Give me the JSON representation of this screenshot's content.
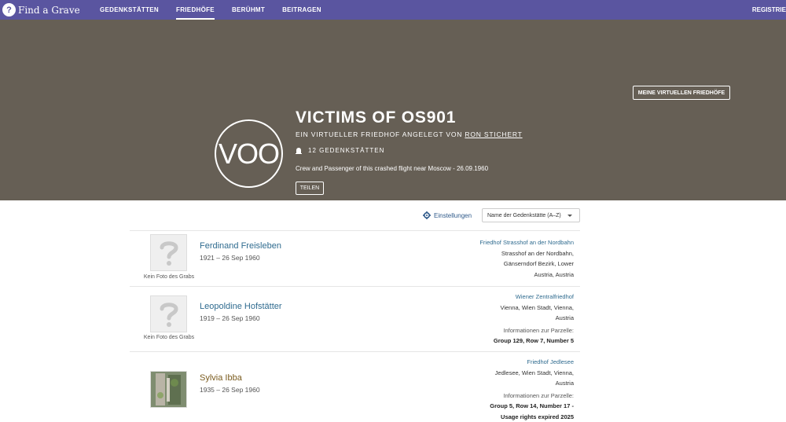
{
  "nav": {
    "logo_text": "Find a Grave",
    "logo_mark": "?",
    "items": [
      "GEDENKSTÄTTEN",
      "FRIEDHÖFE",
      "BERÜHMT",
      "BEITRAGEN"
    ],
    "register": "REGISTRIE"
  },
  "hero": {
    "my_button": "MEINE VIRTUELLEN FRIEDHÖFE",
    "avatar_text": "VOO",
    "title": "VICTIMS OF OS901",
    "subtitle_prefix": "EIN VIRTUELLER FRIEDHOF ANGELEGT VON",
    "creator": "RON STICHERT",
    "count_text": "12 GEDENKSTÄTTEN",
    "description": "Crew and Passenger of this crashed flight near Moscow - 26.09.1960",
    "share_button": "TEILEN"
  },
  "controls": {
    "settings_label": "Einstellungen",
    "sort_value": "Name der Gedenkstätte (A–Z)"
  },
  "entries": [
    {
      "name": "Ferdinand Freisleben",
      "dates": "1921 – 26 Sep 1960",
      "no_photo": "Kein Foto des Grabs",
      "cemetery": "Friedhof Strasshof an der Nordbahn",
      "location_lines": [
        "Strasshof an der Nordbahn,",
        "Gänserndorf Bezirk, Lower",
        "Austria, Austria"
      ]
    },
    {
      "name": "Leopoldine Hofstätter",
      "dates": "1919 – 26 Sep 1960",
      "no_photo": "Kein Foto des Grabs",
      "cemetery": "Wiener Zentralfriedhof",
      "location_lines": [
        "Vienna, Wien Stadt, Vienna,",
        "Austria"
      ],
      "plot_label": "Informationen zur Parzelle:",
      "plot": "Group 129, Row 7, Number 5"
    },
    {
      "name": "Sylvia Ibba",
      "dates": "1935 – 26 Sep 1960",
      "cemetery": "Friedhof Jedlesee",
      "location_lines": [
        "Jedlesee, Wien Stadt, Vienna,",
        "Austria"
      ],
      "plot_label": "Informationen zur Parzelle:",
      "plot_lines": [
        "Group 5, Row 14, Number 17 -",
        "Usage rights expired 2025"
      ]
    }
  ],
  "colors": {
    "nav_bg": "#5a55a0",
    "hero_bg": "#665f55",
    "link_blue": "#2f6b8f",
    "name_brown": "#7a5b1e"
  }
}
